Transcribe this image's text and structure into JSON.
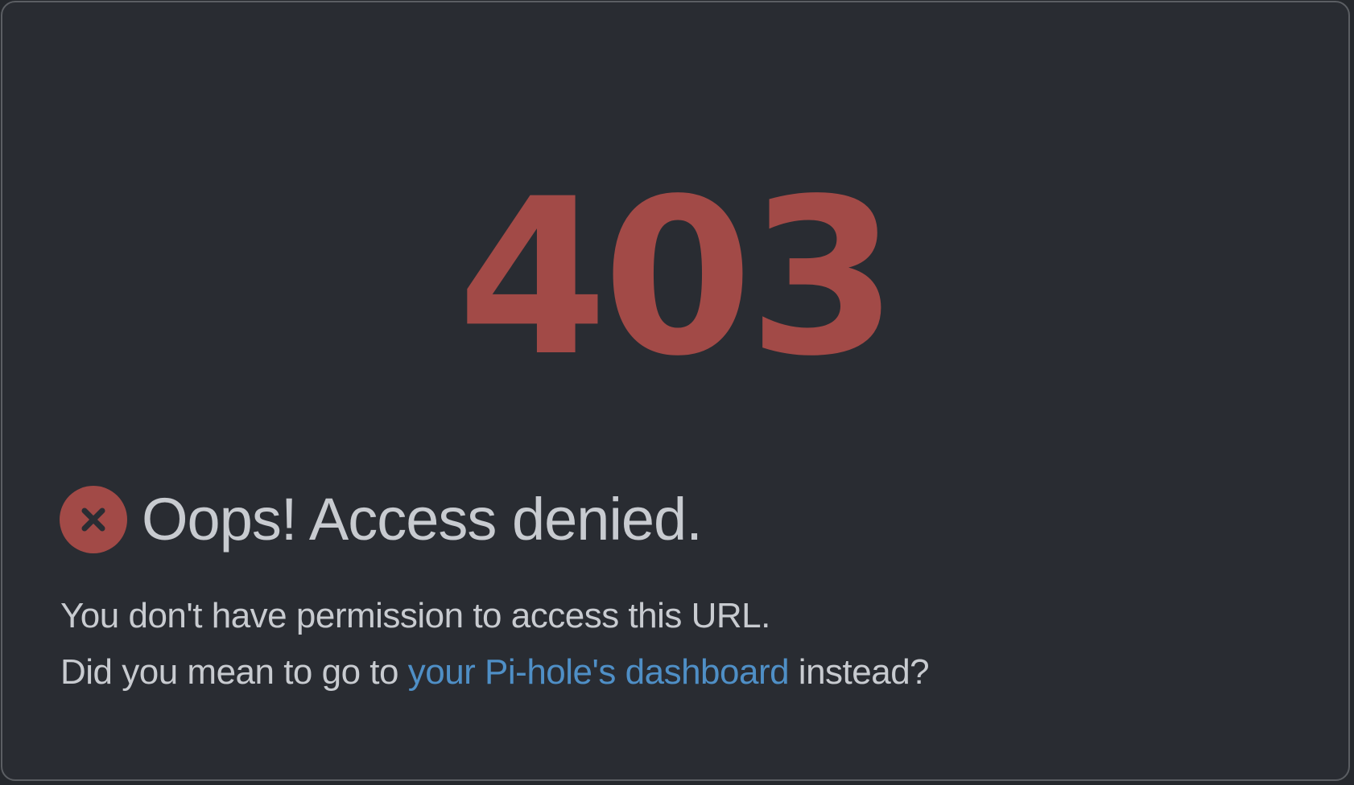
{
  "error": {
    "code": "403",
    "headline": "Oops! Access denied.",
    "icon": "close-circle-icon",
    "message_line1": "You don't have permission to access this URL.",
    "message_line2_before": "Did you mean to go to ",
    "message_line2_link": "your Pi-hole's dashboard",
    "message_line2_after": " instead?"
  },
  "colors": {
    "background": "#292c32",
    "error_red": "#a24a47",
    "text": "#c8cbd0",
    "link": "#4f8fc6"
  }
}
